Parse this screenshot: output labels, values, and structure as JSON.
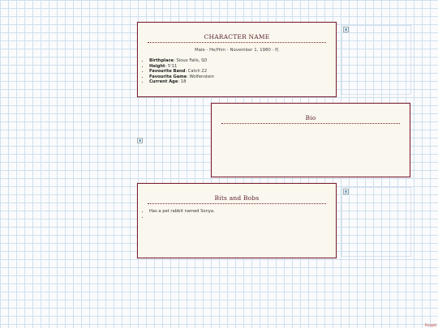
{
  "profile": {
    "title": "CHARACTER NAME",
    "subline": "Male - He/Him - November 1, 1980 - ♏",
    "facts": [
      {
        "label": "Birthplace",
        "value": ": Sioux Falls, SD"
      },
      {
        "label": "Height",
        "value": ": 5'11"
      },
      {
        "label": "Favourite Band",
        "value": ": Catch 22"
      },
      {
        "label": "Favourite Game",
        "value": ": Wolfenstein"
      },
      {
        "label": "Current Age",
        "value": ": 18"
      }
    ]
  },
  "bio": {
    "title": "Bio"
  },
  "bits": {
    "title": "Bits and Bobs",
    "items": [
      "Has a pet rabbit named Sonya.",
      ""
    ]
  },
  "footer": {
    "credit": "Rnepbl"
  }
}
